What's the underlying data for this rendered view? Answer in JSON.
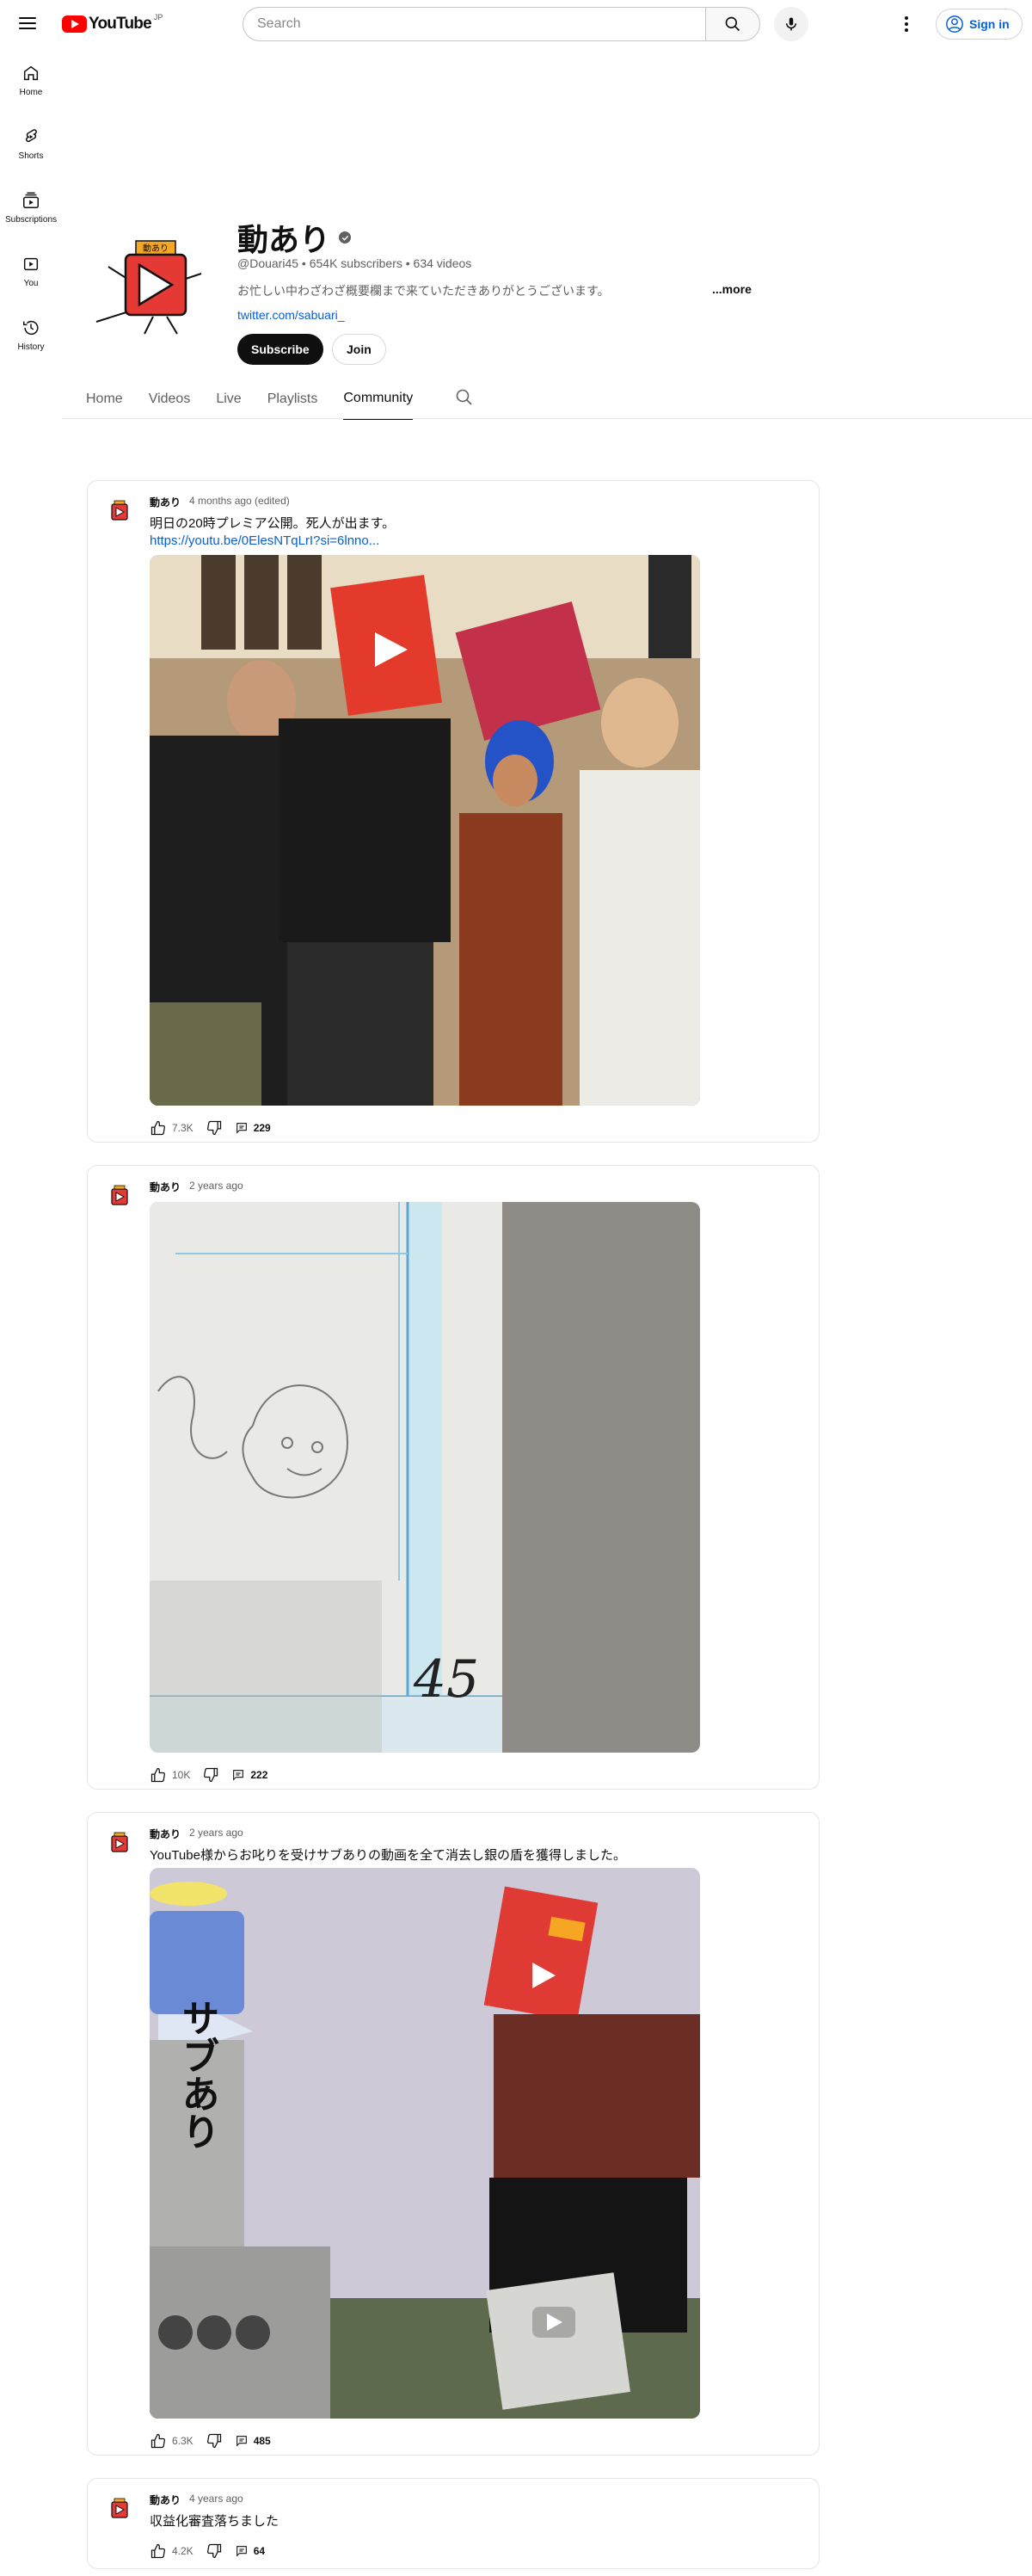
{
  "header": {
    "logo_text": "YouTube",
    "logo_region": "JP",
    "search_placeholder": "Search",
    "signin_label": "Sign in"
  },
  "rail": {
    "items": [
      {
        "label": "Home",
        "icon": "home-icon"
      },
      {
        "label": "Shorts",
        "icon": "shorts-icon"
      },
      {
        "label": "Subscriptions",
        "icon": "subscriptions-icon"
      },
      {
        "label": "You",
        "icon": "you-icon"
      },
      {
        "label": "History",
        "icon": "history-icon"
      }
    ]
  },
  "channel": {
    "name": "動あり",
    "avatar_label": "動あり",
    "meta": "@Douari45 • 654K subscribers • 634 videos",
    "description": "お忙しい中わざわざ概要欄まで来ていただきありがとうございます。",
    "more_label": "...more",
    "link": "twitter.com/sabuari_",
    "subscribe_label": "Subscribe",
    "join_label": "Join",
    "tabs": [
      "Home",
      "Videos",
      "Live",
      "Playlists",
      "Community"
    ],
    "active_tab": "Community"
  },
  "posts": [
    {
      "author": "動あり",
      "time": "4 months ago (edited)",
      "text": "明日の20時プレミア公開。死人が出ます。",
      "link": "https://youtu.be/0ElesNTqLrI?si=6lnno...",
      "likes": "7.3K",
      "comments": "229",
      "image_alt": "group photo"
    },
    {
      "author": "動あり",
      "time": "2 years ago",
      "likes": "10K",
      "comments": "222",
      "image_alt": "drawing on paper",
      "image_number": "45"
    },
    {
      "author": "動あり",
      "time": "2 years ago",
      "text": "YouTube様からお叱りを受けサブありの動画を全て消去し銀の盾を獲得しました。",
      "likes": "6.3K",
      "comments": "485",
      "image_alt": "illustration with silver play button",
      "image_caption": "サブあり"
    },
    {
      "author": "動あり",
      "time": "4 years ago",
      "text": "収益化審査落ちました",
      "likes": "4.2K",
      "comments": "64"
    }
  ],
  "colors": {
    "brand_red": "#ff0000",
    "link_blue": "#065fd4",
    "text_primary": "#0f0f0f",
    "text_secondary": "#606060"
  }
}
